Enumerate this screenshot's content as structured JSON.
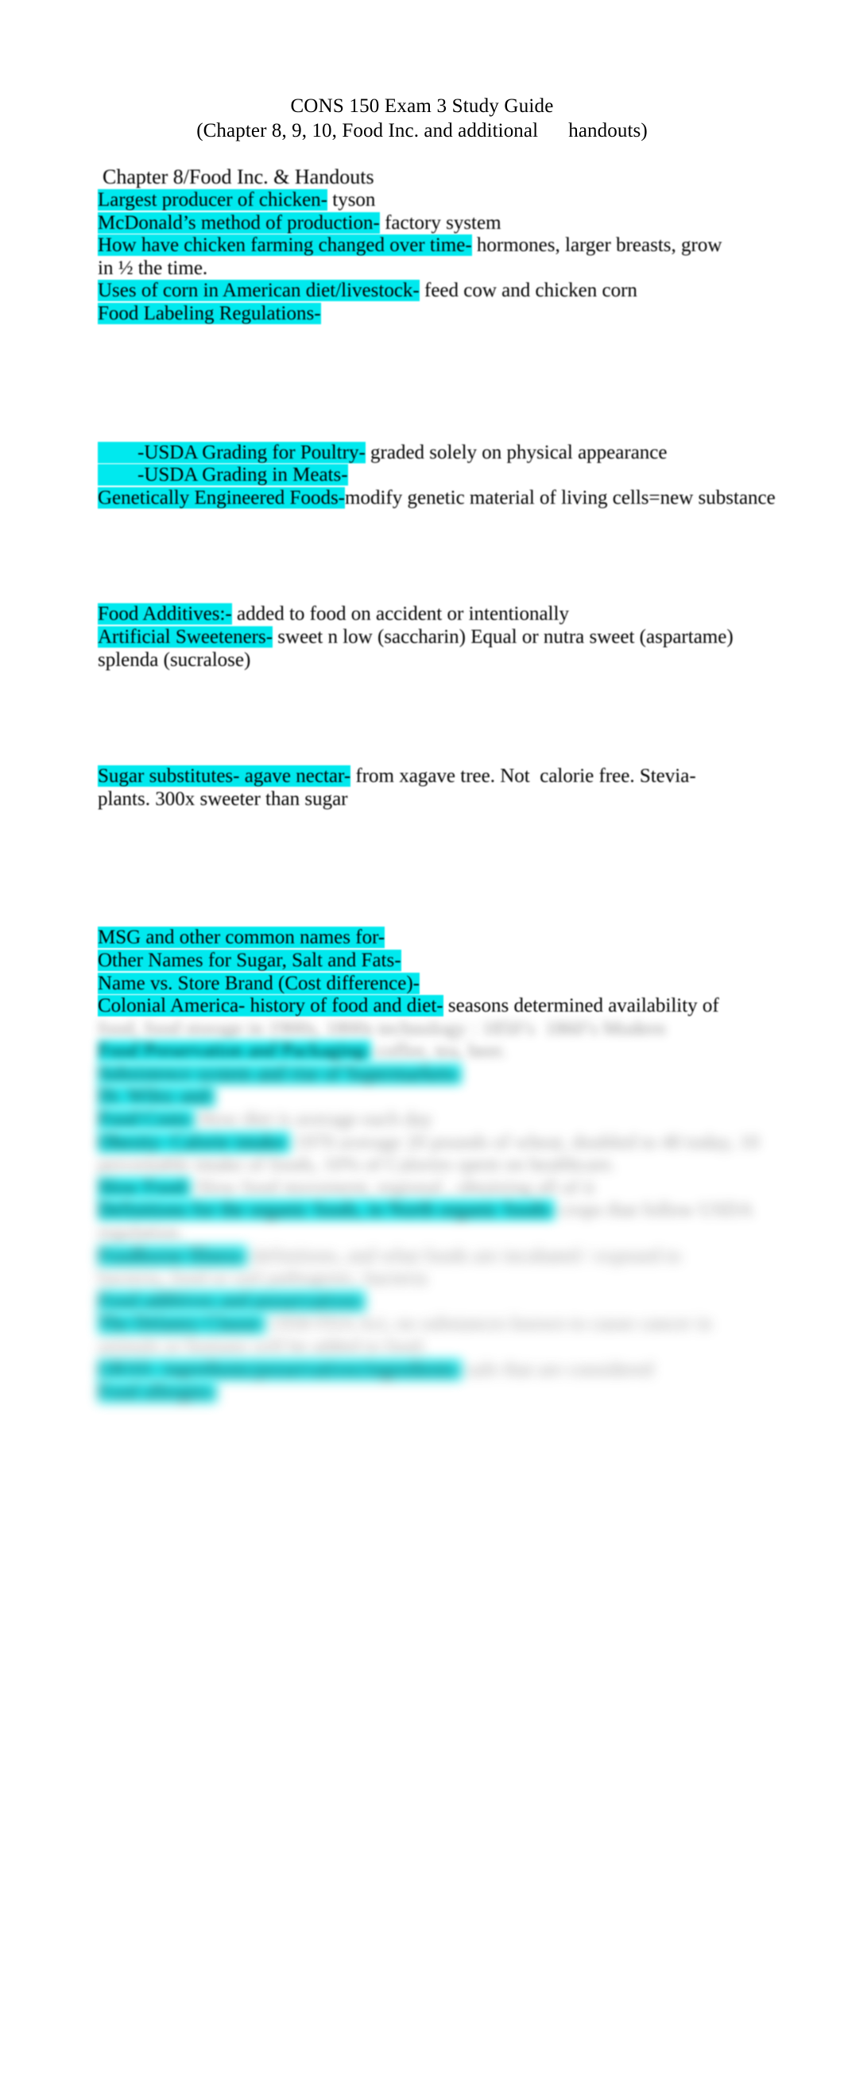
{
  "document": {
    "title_line_1": "CONS 150 Exam 3 Study Guide",
    "title_line_2": "(Chapter 8, 9, 10, Food Inc. and additional      handouts)",
    "highlight_color": "#00e9ee",
    "text_color": "#000000",
    "page_background": "#ffffff"
  },
  "sections": [
    {
      "heading": "Chapter 8/Food Inc. & Handouts",
      "lines": [
        {
          "term": "Largest producer of chicken-",
          "answer": " tyson"
        },
        {
          "term": "McDonald’s method of production-",
          "answer": " factory system"
        },
        {
          "term": "How have chicken farming changed over time-",
          "answer": " hormones, larger breasts, grow"
        },
        {
          "term": "",
          "answer": "in ½ the time."
        },
        {
          "term": "Uses of corn in American diet/livestock-",
          "answer": " feed cow and chicken corn"
        },
        {
          "term": "Food Labeling Regulations-",
          "answer": ""
        }
      ]
    },
    {
      "heading": "",
      "lines": [
        {
          "term": "        -USDA Grading for Poultry-",
          "answer": " graded solely on physical appearance"
        },
        {
          "term": "        -USDA Grading in Meats-",
          "answer": ""
        },
        {
          "term": "Genetically Engineered Foods-",
          "answer": "modify genetic material of living cells=new substance"
        }
      ]
    },
    {
      "heading": "",
      "lines": [
        {
          "term": "Food Additives:-",
          "answer": " added to food on accident or intentionally"
        },
        {
          "term": "Artificial Sweeteners-",
          "answer": " sweet n low (saccharin) Equal or nutra sweet (aspartame)"
        },
        {
          "term": "",
          "answer": "splenda (sucralose)"
        }
      ]
    },
    {
      "heading": "",
      "lines": [
        {
          "term": "Sugar substitutes- agave nectar-",
          "answer": " from xagave tree. Not  calorie free. Stevia-"
        },
        {
          "term": "",
          "answer": "plants. 300x sweeter than sugar"
        }
      ]
    },
    {
      "heading": "",
      "lines": [
        {
          "term": "MSG and other common names for-",
          "answer": ""
        },
        {
          "term": "Other Names for Sugar, Salt and Fats-",
          "answer": ""
        },
        {
          "term": "Name vs. Store Brand (Cost difference)-",
          "answer": ""
        },
        {
          "term": "Colonial America- history of food and diet-",
          "answer": " seasons determined availability of"
        }
      ]
    }
  ],
  "obscured": {
    "note": "lower portion of page is blurred and illegible",
    "lines": [
      {
        "term": "",
        "answer": "food, food storage in 1900s, 1800s technology : 1850’s  1860’s Modern",
        "blur": 1
      },
      {
        "term": "Food Preservation and Packaging-",
        "answer": " coffee, tea, beer.",
        "blur": 1
      },
      {
        "term": "Subsistence system and rise of Supermarkets-",
        "answer": "",
        "blur": 2
      },
      {
        "term": "Dr. Wiley and-",
        "answer": "",
        "blur": 2
      },
      {
        "term": "Food Costs-",
        "answer": " How diet is average each day",
        "blur": 2
      },
      {
        "term": "Obesity- Calorie intake-",
        "answer": " 1970 average 20 pounds of wheat, doubled to 40 today, 10",
        "blur": 2
      },
      {
        "term": "",
        "answer": "percentable intake of foods, 10% of Calories spent on healthcare.",
        "blur": 2
      },
      {
        "term": "Slow Food-",
        "answer": " Slow food movement, regional , obtaining all of it",
        "blur": 2
      },
      {
        "term": "Definitions for the organic foods, in North organic foods-",
        "answer": " crops that follow USDA regulation.",
        "blur": 2
      },
      {
        "term": "Foodborne Illness-",
        "answer": " definitions, and what foods are incubated / exposed to",
        "blur": 3
      },
      {
        "term": "",
        "answer": "bacteria, food or soil pathogenic, bacteria",
        "blur": 3
      },
      {
        "term": "Food additives and preservatives-",
        "answer": "",
        "blur": 3
      },
      {
        "term": "The Delaney Clause-",
        "answer": " 1958 FDA Act, no substances known to cause cancer in",
        "blur": 3
      },
      {
        "term": "",
        "answer": "animals or humans will be added to food.",
        "blur": 3
      },
      {
        "term": "GRAS- ingredients/preservatives/ingredients-",
        "answer": " safe that are considered",
        "blur": 3
      },
      {
        "term": "Food allergies-",
        "answer": "",
        "blur": 3
      }
    ]
  }
}
